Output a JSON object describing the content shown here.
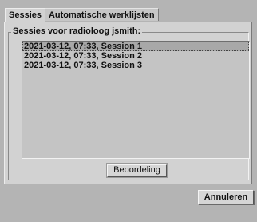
{
  "tabs": [
    {
      "label": "Sessies",
      "active": true
    },
    {
      "label": "Automatische werklijsten",
      "active": false
    }
  ],
  "group": {
    "title": "Sessies voor radioloog jsmith:"
  },
  "sessions": [
    {
      "label": "2021-03-12, 07:33, Session 1",
      "selected": true
    },
    {
      "label": "2021-03-12, 07:33, Session 2",
      "selected": false
    },
    {
      "label": "2021-03-12, 07:33, Session 3",
      "selected": false
    }
  ],
  "buttons": {
    "review_label": "Beoordeling",
    "cancel_label": "Annuleren"
  },
  "colors": {
    "window_bg": "#b4b4b4",
    "panel_bg": "#d2d2d2",
    "list_bg": "#c4c4c4",
    "selected_bg": "#a8a8a8"
  }
}
